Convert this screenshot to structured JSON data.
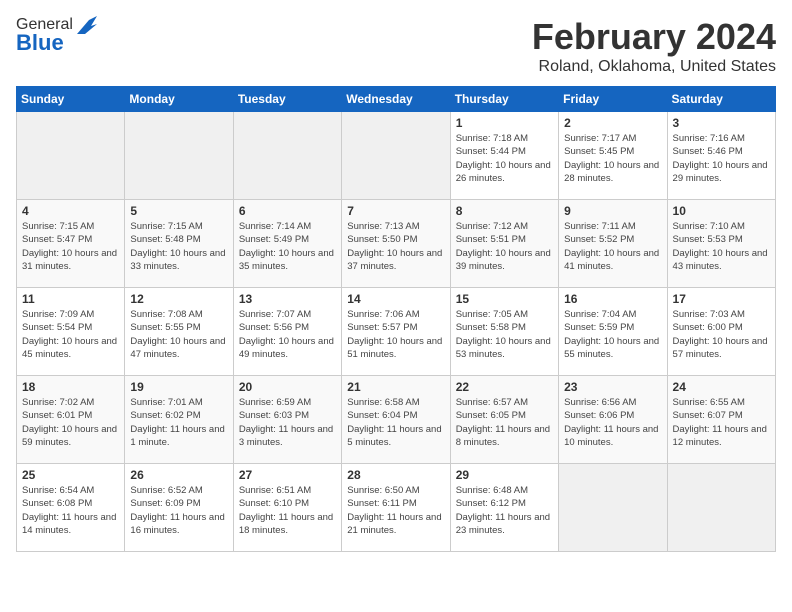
{
  "header": {
    "logo_general": "General",
    "logo_blue": "Blue",
    "title": "February 2024",
    "subtitle": "Roland, Oklahoma, United States"
  },
  "days_of_week": [
    "Sunday",
    "Monday",
    "Tuesday",
    "Wednesday",
    "Thursday",
    "Friday",
    "Saturday"
  ],
  "weeks": [
    [
      {
        "day": "",
        "info": ""
      },
      {
        "day": "",
        "info": ""
      },
      {
        "day": "",
        "info": ""
      },
      {
        "day": "",
        "info": ""
      },
      {
        "day": "1",
        "info": "Sunrise: 7:18 AM\nSunset: 5:44 PM\nDaylight: 10 hours and 26 minutes."
      },
      {
        "day": "2",
        "info": "Sunrise: 7:17 AM\nSunset: 5:45 PM\nDaylight: 10 hours and 28 minutes."
      },
      {
        "day": "3",
        "info": "Sunrise: 7:16 AM\nSunset: 5:46 PM\nDaylight: 10 hours and 29 minutes."
      }
    ],
    [
      {
        "day": "4",
        "info": "Sunrise: 7:15 AM\nSunset: 5:47 PM\nDaylight: 10 hours and 31 minutes."
      },
      {
        "day": "5",
        "info": "Sunrise: 7:15 AM\nSunset: 5:48 PM\nDaylight: 10 hours and 33 minutes."
      },
      {
        "day": "6",
        "info": "Sunrise: 7:14 AM\nSunset: 5:49 PM\nDaylight: 10 hours and 35 minutes."
      },
      {
        "day": "7",
        "info": "Sunrise: 7:13 AM\nSunset: 5:50 PM\nDaylight: 10 hours and 37 minutes."
      },
      {
        "day": "8",
        "info": "Sunrise: 7:12 AM\nSunset: 5:51 PM\nDaylight: 10 hours and 39 minutes."
      },
      {
        "day": "9",
        "info": "Sunrise: 7:11 AM\nSunset: 5:52 PM\nDaylight: 10 hours and 41 minutes."
      },
      {
        "day": "10",
        "info": "Sunrise: 7:10 AM\nSunset: 5:53 PM\nDaylight: 10 hours and 43 minutes."
      }
    ],
    [
      {
        "day": "11",
        "info": "Sunrise: 7:09 AM\nSunset: 5:54 PM\nDaylight: 10 hours and 45 minutes."
      },
      {
        "day": "12",
        "info": "Sunrise: 7:08 AM\nSunset: 5:55 PM\nDaylight: 10 hours and 47 minutes."
      },
      {
        "day": "13",
        "info": "Sunrise: 7:07 AM\nSunset: 5:56 PM\nDaylight: 10 hours and 49 minutes."
      },
      {
        "day": "14",
        "info": "Sunrise: 7:06 AM\nSunset: 5:57 PM\nDaylight: 10 hours and 51 minutes."
      },
      {
        "day": "15",
        "info": "Sunrise: 7:05 AM\nSunset: 5:58 PM\nDaylight: 10 hours and 53 minutes."
      },
      {
        "day": "16",
        "info": "Sunrise: 7:04 AM\nSunset: 5:59 PM\nDaylight: 10 hours and 55 minutes."
      },
      {
        "day": "17",
        "info": "Sunrise: 7:03 AM\nSunset: 6:00 PM\nDaylight: 10 hours and 57 minutes."
      }
    ],
    [
      {
        "day": "18",
        "info": "Sunrise: 7:02 AM\nSunset: 6:01 PM\nDaylight: 10 hours and 59 minutes."
      },
      {
        "day": "19",
        "info": "Sunrise: 7:01 AM\nSunset: 6:02 PM\nDaylight: 11 hours and 1 minute."
      },
      {
        "day": "20",
        "info": "Sunrise: 6:59 AM\nSunset: 6:03 PM\nDaylight: 11 hours and 3 minutes."
      },
      {
        "day": "21",
        "info": "Sunrise: 6:58 AM\nSunset: 6:04 PM\nDaylight: 11 hours and 5 minutes."
      },
      {
        "day": "22",
        "info": "Sunrise: 6:57 AM\nSunset: 6:05 PM\nDaylight: 11 hours and 8 minutes."
      },
      {
        "day": "23",
        "info": "Sunrise: 6:56 AM\nSunset: 6:06 PM\nDaylight: 11 hours and 10 minutes."
      },
      {
        "day": "24",
        "info": "Sunrise: 6:55 AM\nSunset: 6:07 PM\nDaylight: 11 hours and 12 minutes."
      }
    ],
    [
      {
        "day": "25",
        "info": "Sunrise: 6:54 AM\nSunset: 6:08 PM\nDaylight: 11 hours and 14 minutes."
      },
      {
        "day": "26",
        "info": "Sunrise: 6:52 AM\nSunset: 6:09 PM\nDaylight: 11 hours and 16 minutes."
      },
      {
        "day": "27",
        "info": "Sunrise: 6:51 AM\nSunset: 6:10 PM\nDaylight: 11 hours and 18 minutes."
      },
      {
        "day": "28",
        "info": "Sunrise: 6:50 AM\nSunset: 6:11 PM\nDaylight: 11 hours and 21 minutes."
      },
      {
        "day": "29",
        "info": "Sunrise: 6:48 AM\nSunset: 6:12 PM\nDaylight: 11 hours and 23 minutes."
      },
      {
        "day": "",
        "info": ""
      },
      {
        "day": "",
        "info": ""
      }
    ]
  ]
}
